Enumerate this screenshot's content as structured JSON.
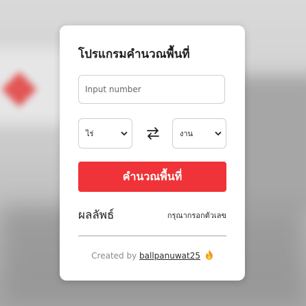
{
  "card": {
    "title": "โปรแกรมคำนวณพื้นที่",
    "input_placeholder": "Input number",
    "from_unit": "ไร่",
    "to_unit": "งาน",
    "calculate_label": "คำนวณพื้นที่",
    "result_label": "ผลลัพธ์",
    "result_value": "กรุณากรอกตัวเลข"
  },
  "footer": {
    "created_by": "Created by",
    "author": "ballpanuwat25"
  },
  "colors": {
    "accent": "#ef3338",
    "card_bg": "#ffffff"
  },
  "icons": [
    "swap-arrows-icon",
    "chevron-down-icon",
    "fire-icon"
  ]
}
